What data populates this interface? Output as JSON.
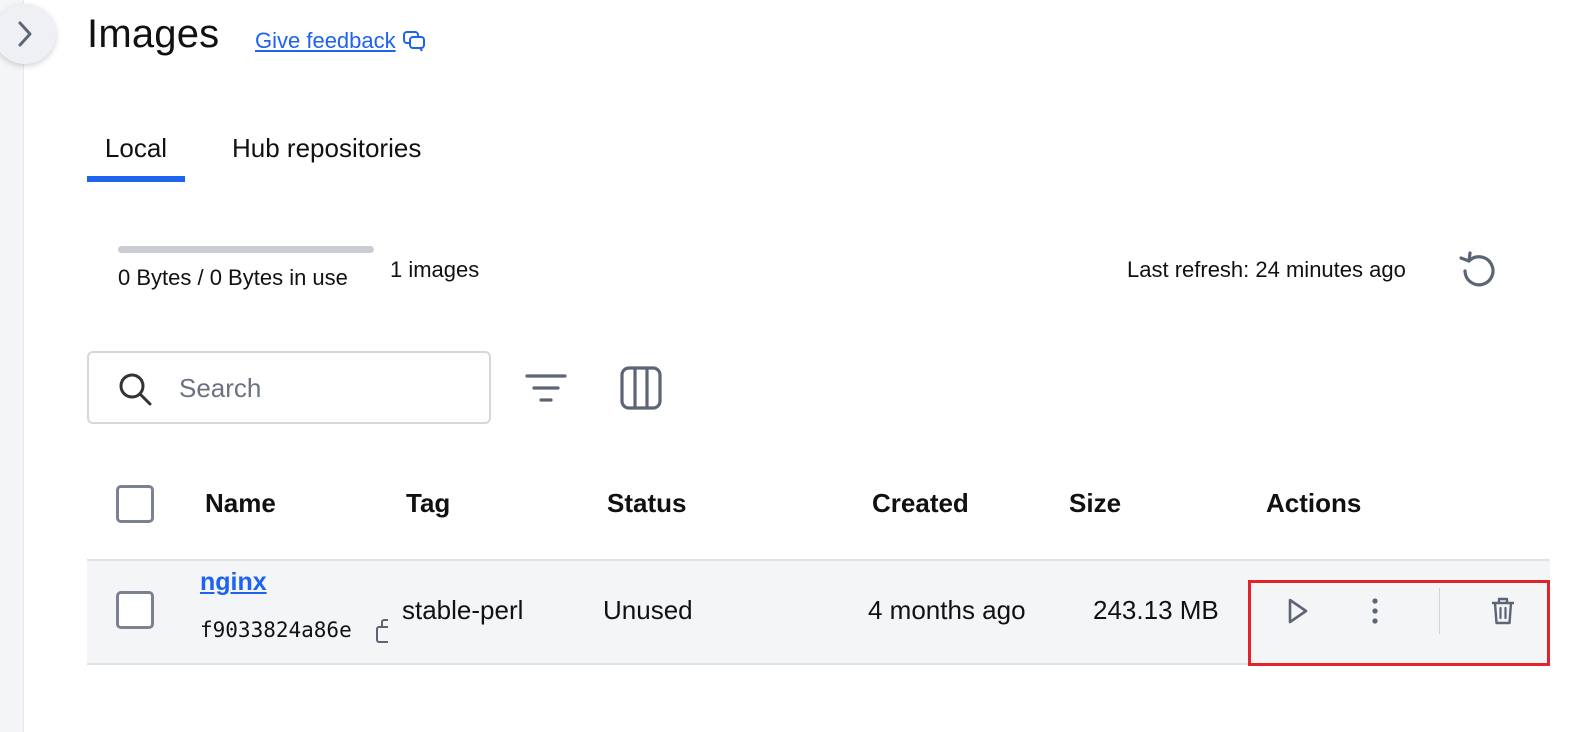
{
  "header": {
    "title": "Images",
    "feedback_label": "Give feedback"
  },
  "tabs": [
    {
      "label": "Local",
      "active": true
    },
    {
      "label": "Hub repositories",
      "active": false
    }
  ],
  "usage": {
    "text": "0 Bytes / 0 Bytes in use",
    "fraction_used": 0,
    "image_count": "1 images",
    "last_refresh": "Last refresh: 24 minutes ago"
  },
  "search": {
    "placeholder": "Search",
    "value": ""
  },
  "table": {
    "columns": [
      "Name",
      "Tag",
      "Status",
      "Created",
      "Size",
      "Actions"
    ],
    "rows": [
      {
        "name": "nginx",
        "id": "f9033824a86e",
        "tag": "stable-perl",
        "status": "Unused",
        "created": "4 months ago",
        "size": "243.13 MB",
        "actions": [
          "run-icon",
          "more-vertical-icon",
          "trash-icon"
        ]
      }
    ]
  },
  "colors": {
    "accent": "#1d63ed",
    "highlight_outline": "#e3222b",
    "icon_gray": "#5c6575"
  },
  "icons": [
    "chevron-right-icon",
    "feedback-icon",
    "refresh-icon",
    "search-icon",
    "filter-icon",
    "columns-icon",
    "copy-icon",
    "run-icon",
    "more-vertical-icon",
    "trash-icon"
  ]
}
